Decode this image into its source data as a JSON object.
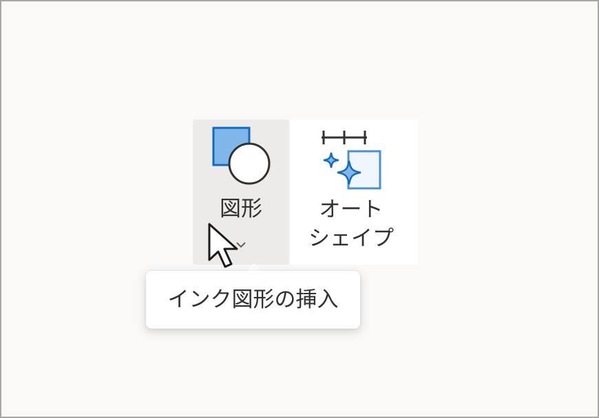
{
  "ribbon": {
    "shapes_button": {
      "label": "図形",
      "icon": "shapes-icon"
    },
    "autoshape_button": {
      "label_line1": "オート",
      "label_line2": "シェイプ",
      "icon": "autoshape-sparkle-icon"
    }
  },
  "tooltip": {
    "text": "インク図形の挿入"
  },
  "colors": {
    "button_hover_bg": "#edebe9",
    "accent_blue": "#0f6cbd",
    "accent_light_blue": "#7fb7ea",
    "text": "#323130"
  }
}
